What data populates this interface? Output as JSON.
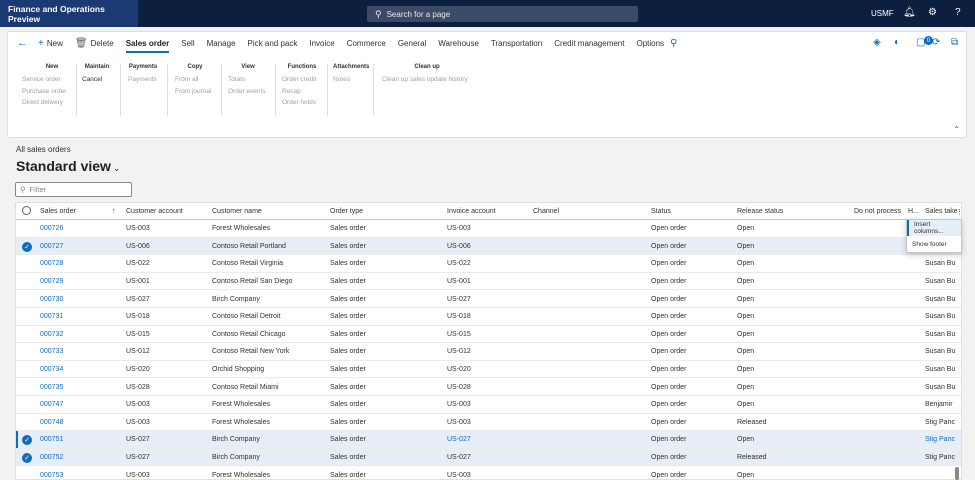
{
  "app": {
    "title": "Finance and Operations Preview",
    "search_placeholder": "Search for a page",
    "company": "USMF"
  },
  "icons": {
    "bell": "bell-icon",
    "gear": "gear-icon",
    "help": "help-icon",
    "notification_count": "0"
  },
  "actionpane": {
    "new_label": "New",
    "delete_label": "Delete",
    "tabs": [
      "Sales order",
      "Sell",
      "Manage",
      "Pick and pack",
      "Invoice",
      "Commerce",
      "General",
      "Warehouse",
      "Transportation",
      "Credit management",
      "Options"
    ],
    "groups": [
      {
        "title": "New",
        "items": [
          "Service order",
          "Purchase order",
          "Direct delivery"
        ]
      },
      {
        "title": "Maintain",
        "items": [
          "Cancel"
        ]
      },
      {
        "title": "Payments",
        "items": [
          "Payments"
        ]
      },
      {
        "title": "Copy",
        "items": [
          "From all",
          "From journal"
        ]
      },
      {
        "title": "View",
        "items": [
          "Totals",
          "Order events"
        ]
      },
      {
        "title": "Functions",
        "items": [
          "Order credit",
          "Recap",
          "Order holds"
        ]
      },
      {
        "title": "Attachments",
        "items": [
          "Notes"
        ]
      },
      {
        "title": "Clean up",
        "items": [
          "Clean up sales update history"
        ]
      }
    ]
  },
  "page": {
    "breadcrumb": "All sales orders",
    "view_name": "Standard view",
    "filter_placeholder": "Filter"
  },
  "grid": {
    "columns": [
      "Sales order",
      "Customer account",
      "Customer name",
      "Order type",
      "Invoice account",
      "Channel",
      "Status",
      "Release status",
      "Do not process",
      "H...",
      "Sales take"
    ],
    "rows": [
      {
        "order": "000726",
        "account": "US-003",
        "name": "Forest Wholesales",
        "type": "Sales order",
        "invoice": "US-003",
        "status": "Open order",
        "release": "Open",
        "taker": ""
      },
      {
        "order": "000727",
        "account": "US-006",
        "name": "Contoso Retail Portland",
        "type": "Sales order",
        "invoice": "US-006",
        "status": "Open order",
        "release": "Open",
        "taker": ""
      },
      {
        "order": "000728",
        "account": "US-022",
        "name": "Contoso Retail Virginia",
        "type": "Sales order",
        "invoice": "US-022",
        "status": "Open order",
        "release": "Open",
        "taker": "Susan Bu"
      },
      {
        "order": "000729",
        "account": "US-001",
        "name": "Contoso Retail San Diego",
        "type": "Sales order",
        "invoice": "US-001",
        "status": "Open order",
        "release": "Open",
        "taker": "Susan Bu"
      },
      {
        "order": "000730",
        "account": "US-027",
        "name": "Birch Company",
        "type": "Sales order",
        "invoice": "US-027",
        "status": "Open order",
        "release": "Open",
        "taker": "Susan Bu"
      },
      {
        "order": "000731",
        "account": "US-018",
        "name": "Contoso Retail Detroit",
        "type": "Sales order",
        "invoice": "US-018",
        "status": "Open order",
        "release": "Open",
        "taker": "Susan Bu"
      },
      {
        "order": "000732",
        "account": "US-015",
        "name": "Contoso Retail Chicago",
        "type": "Sales order",
        "invoice": "US-015",
        "status": "Open order",
        "release": "Open",
        "taker": "Susan Bu"
      },
      {
        "order": "000733",
        "account": "US-012",
        "name": "Contoso Retail New York",
        "type": "Sales order",
        "invoice": "US-012",
        "status": "Open order",
        "release": "Open",
        "taker": "Susan Bu"
      },
      {
        "order": "000734",
        "account": "US-020",
        "name": "Orchid Shopping",
        "type": "Sales order",
        "invoice": "US-020",
        "status": "Open order",
        "release": "Open",
        "taker": "Susan Bu"
      },
      {
        "order": "000735",
        "account": "US-028",
        "name": "Contoso Retail Miami",
        "type": "Sales order",
        "invoice": "US-028",
        "status": "Open order",
        "release": "Open",
        "taker": "Susan Bu"
      },
      {
        "order": "000747",
        "account": "US-003",
        "name": "Forest Wholesales",
        "type": "Sales order",
        "invoice": "US-003",
        "status": "Open order",
        "release": "Open",
        "taker": "Benjamir"
      },
      {
        "order": "000748",
        "account": "US-003",
        "name": "Forest Wholesales",
        "type": "Sales order",
        "invoice": "US-003",
        "status": "Open order",
        "release": "Released",
        "taker": "Stig Panc"
      },
      {
        "order": "000751",
        "account": "US-027",
        "name": "Birch Company",
        "type": "Sales order",
        "invoice": "US-027",
        "status": "Open order",
        "release": "Open",
        "taker": "Stig Panc"
      },
      {
        "order": "000752",
        "account": "US-027",
        "name": "Birch Company",
        "type": "Sales order",
        "invoice": "US-027",
        "status": "Open order",
        "release": "Released",
        "taker": "Stig Panc"
      },
      {
        "order": "000753",
        "account": "US-003",
        "name": "Forest Wholesales",
        "type": "Sales order",
        "invoice": "US-003",
        "status": "Open order",
        "release": "Open",
        "taker": ""
      }
    ],
    "selected_orders": [
      "000727",
      "000751",
      "000752"
    ],
    "focused_order": "000751"
  },
  "context_menu": {
    "items": [
      "Insert columns...",
      "Show footer"
    ]
  },
  "colors": {
    "brand_bar": "#1b3a73",
    "nav_bg": "#0c1f3f",
    "accent": "#0f6cbd",
    "selected_row": "#e6eef8"
  }
}
